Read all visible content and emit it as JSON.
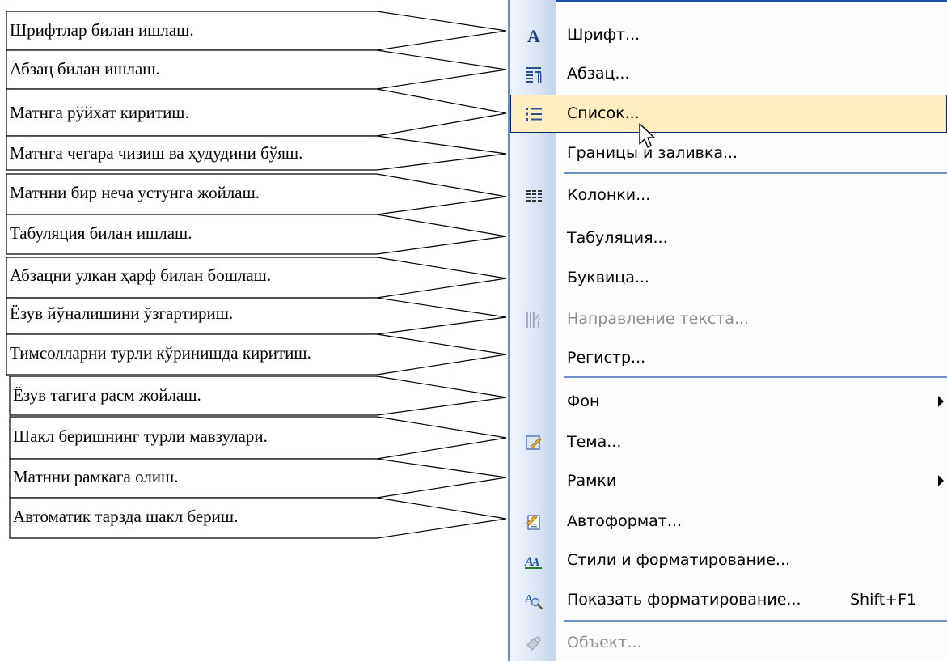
{
  "callouts": [
    {
      "text": "Шрифтлар билан ишлаш."
    },
    {
      "text": "Абзац билан ишлаш."
    },
    {
      "text": "Матнга рўйхат киритиш."
    },
    {
      "text": "Матнга чегара чизиш ва ҳудудини бўяш."
    },
    {
      "text": "Матнни бир неча устунга жойлаш."
    },
    {
      "text": "Табуляция билан ишлаш."
    },
    {
      "text": "Абзацни улкан ҳарф билан бошлаш."
    },
    {
      "text": "Ёзув йўналишини ўзгартириш."
    },
    {
      "text": "Тимсолларни турли кўринишда киритиш."
    },
    {
      "text": "Ёзув тагига расм жойлаш."
    },
    {
      "text": "Шакл беришнинг турли мавзулари."
    },
    {
      "text": "Матнни рамкага олиш."
    },
    {
      "text": "Автоматик тарзда шакл бериш."
    }
  ],
  "menu": {
    "items": [
      {
        "label": "Шрифт...",
        "icon": "font-icon",
        "state": "normal"
      },
      {
        "label": "Абзац...",
        "icon": "paragraph-icon",
        "state": "normal"
      },
      {
        "label": "Список...",
        "icon": "bullet-list-icon",
        "state": "selected"
      },
      {
        "label": "Границы и заливка...",
        "icon": "",
        "state": "normal"
      },
      {
        "label": "Колонки...",
        "icon": "columns-icon",
        "state": "normal"
      },
      {
        "label": "Табуляция...",
        "icon": "",
        "state": "normal"
      },
      {
        "label": "Буквица...",
        "icon": "",
        "state": "normal"
      },
      {
        "label": "Направление текста...",
        "icon": "text-direction-icon",
        "state": "disabled"
      },
      {
        "label": "Регистр...",
        "icon": "",
        "state": "normal"
      },
      {
        "label": "Фон",
        "icon": "",
        "state": "normal",
        "submenu": true
      },
      {
        "label": "Тема...",
        "icon": "theme-icon",
        "state": "normal"
      },
      {
        "label": "Рамки",
        "icon": "",
        "state": "normal",
        "submenu": true
      },
      {
        "label": "Автоформат...",
        "icon": "autoformat-icon",
        "state": "normal"
      },
      {
        "label": "Стили и форматирование...",
        "icon": "styles-icon",
        "state": "normal"
      },
      {
        "label": "Показать форматирование...",
        "icon": "reveal-formatting-icon",
        "state": "normal",
        "shortcut": "Shift+F1"
      },
      {
        "label": "Объект...",
        "icon": "object-icon",
        "state": "disabled"
      }
    ]
  },
  "colors": {
    "menu_accent": "#1d4ea8",
    "selection_bg": "#ffeec2",
    "selection_border": "#0a246a",
    "disabled_text": "#8d8d8d"
  }
}
